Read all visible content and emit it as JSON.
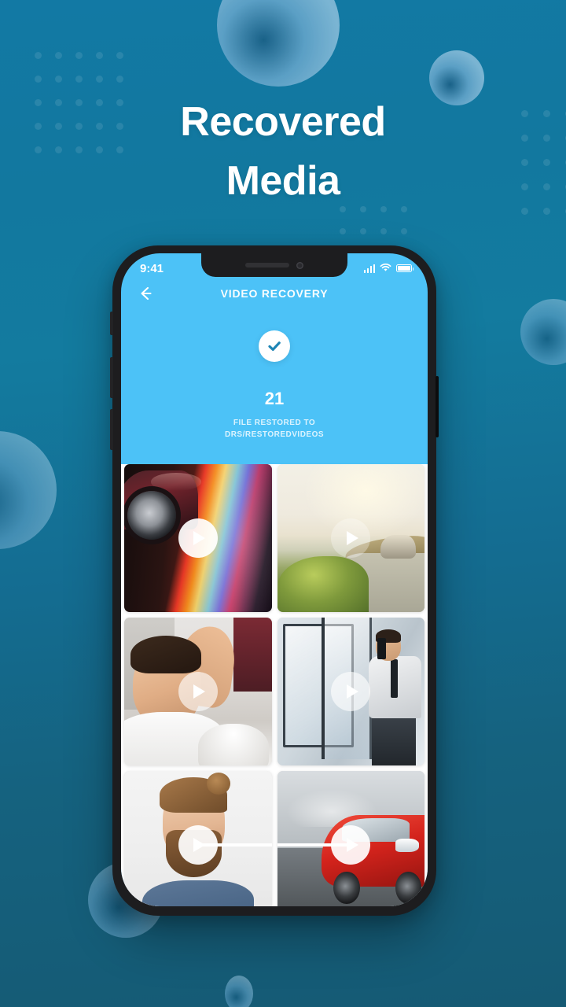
{
  "headline": {
    "line1": "Recovered",
    "line2": "Media"
  },
  "phone": {
    "status_bar": {
      "time": "9:41",
      "icons": [
        "cellular-signal-icon",
        "wifi-icon",
        "battery-icon"
      ]
    },
    "app_bar": {
      "back_icon": "back-arrow-icon",
      "title": "VIDEO RECOVERY"
    },
    "hero": {
      "check_icon": "check-circle-icon",
      "count": "21",
      "subtitle_line1": "FILE RESTORED TO",
      "subtitle_line2": "DRS/RESTOREDVIDEOS"
    },
    "grid": {
      "play_icon": "play-icon",
      "items": [
        {
          "caption": "sports car light-streak video",
          "art": "a-car-speed",
          "play": "solid"
        },
        {
          "caption": "mountain road sunset car video",
          "art": "a-road",
          "play": "faint"
        },
        {
          "caption": "smiling man in white shirt video",
          "art": "a-man-smile",
          "play": "dim"
        },
        {
          "caption": "security guard with radio video",
          "art": "a-security",
          "play": "dim"
        },
        {
          "caption": "man with hair bun and beard video",
          "art": "a-bun-man",
          "play": "solid"
        },
        {
          "caption": "red hatchback on road video",
          "art": "a-red-car",
          "play": "solid"
        }
      ]
    }
  },
  "colors": {
    "background_top": "#1279a4",
    "background_bottom": "#155a74",
    "app_accent": "#4cc2f7",
    "headline_text": "#ffffff",
    "phone_frame": "#1d1d1f"
  }
}
